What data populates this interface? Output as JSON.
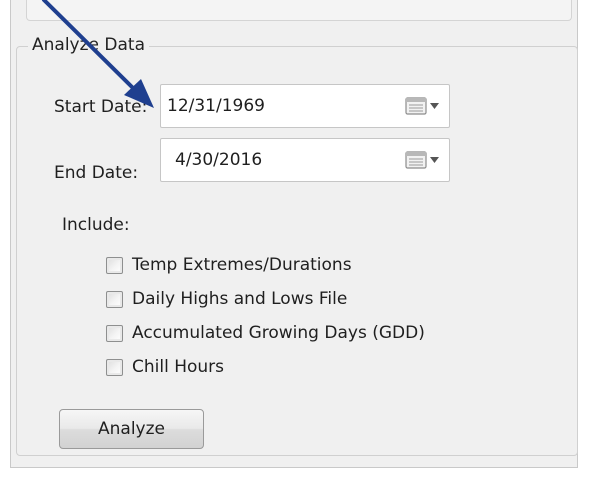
{
  "group": {
    "title": "Analyze Data"
  },
  "start_date": {
    "label": "Start Date:",
    "value": "12/31/1969"
  },
  "end_date": {
    "label": "End Date:",
    "value": "4/30/2016"
  },
  "include": {
    "label": "Include:",
    "options": [
      {
        "label": "Temp Extremes/Durations",
        "checked": false
      },
      {
        "label": "Daily Highs and Lows File",
        "checked": false
      },
      {
        "label": "Accumulated Growing Days (GDD)",
        "checked": false
      },
      {
        "label": "Chill Hours",
        "checked": false
      }
    ]
  },
  "analyze_button": {
    "label": "Analyze"
  },
  "colors": {
    "panel": "#f0f0f0",
    "arrow": "#1f3f8f"
  },
  "icons": {
    "calendar": "calendar-icon",
    "dropdown": "chevron-down-icon",
    "annotation": "annotation-arrow-icon"
  }
}
